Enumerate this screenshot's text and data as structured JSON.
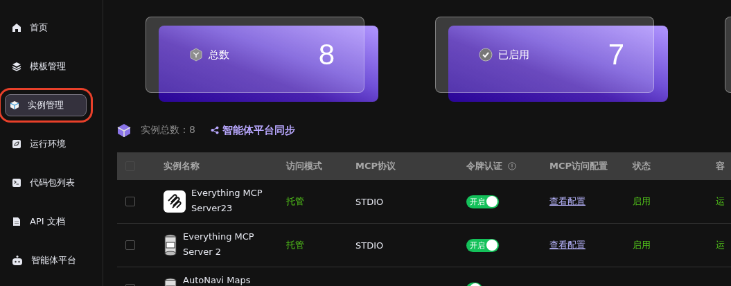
{
  "sidebar": {
    "items": [
      {
        "label": "首页",
        "selected": false
      },
      {
        "label": "模板管理",
        "selected": false
      },
      {
        "label": "实例管理",
        "selected": true
      },
      {
        "label": "运行环境",
        "selected": false
      },
      {
        "label": "代码包列表",
        "selected": false
      },
      {
        "label": "API 文档",
        "selected": false
      },
      {
        "label": "智能体平台",
        "selected": false
      }
    ]
  },
  "stat_cards": [
    {
      "label": "总数",
      "value": "8"
    },
    {
      "label": "已启用",
      "value": "7"
    }
  ],
  "summary": {
    "count_text": "实例总数：8",
    "sync_link": "智能体平台同步"
  },
  "table": {
    "header_checked": false,
    "columns": [
      "实例名称",
      "访问模式",
      "MCP协议",
      "令牌认证",
      "MCP访问配置",
      "状态",
      "容"
    ],
    "rows": [
      {
        "checked": false,
        "name": "Everything MCP Server23",
        "mode": "托管",
        "protocol": "STDIO",
        "token": {
          "on": true,
          "label": "开启"
        },
        "config": "查看配置",
        "status": "启用",
        "container": "运"
      },
      {
        "checked": false,
        "name": "Everything MCP Server 2",
        "mode": "托管",
        "protocol": "STDIO",
        "token": {
          "on": true,
          "label": "开启"
        },
        "config": "查看配置",
        "status": "启用",
        "container": "运"
      },
      {
        "checked": false,
        "name": "AutoNavi Maps",
        "token": {
          "on": true
        }
      }
    ]
  }
}
